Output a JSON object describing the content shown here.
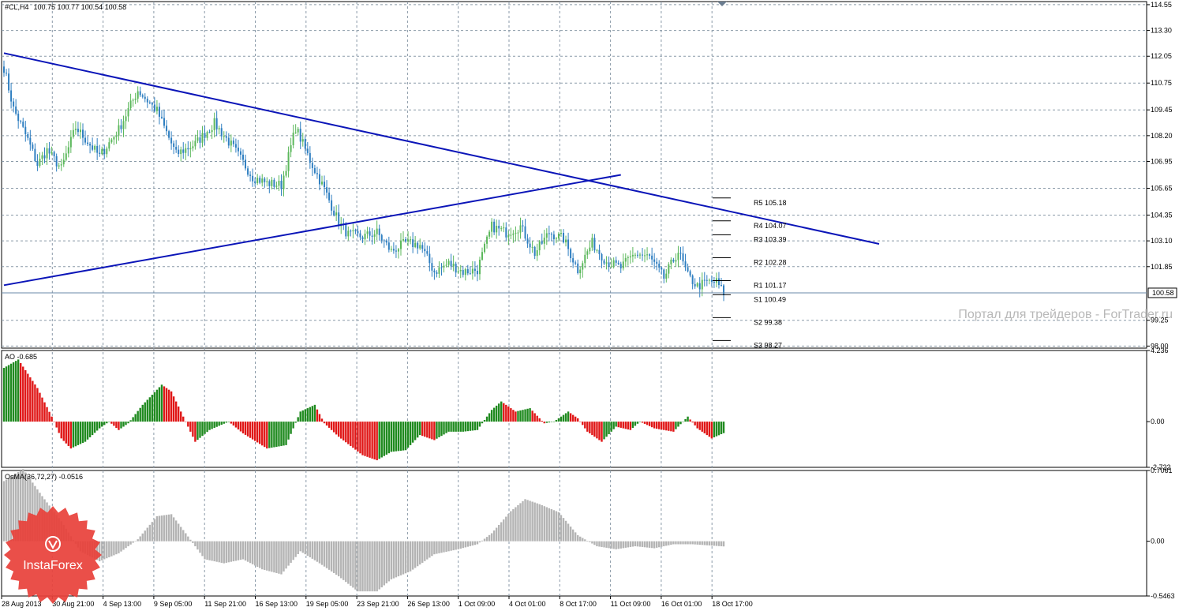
{
  "colors": {
    "background": "#ffffff",
    "grid": "#8a9aa8",
    "bull_candle": "#5cb85c",
    "bear_candle": "#2f7fc1",
    "trendline": "#0b15b8",
    "ao_up": "#1f8a1f",
    "ao_down": "#e01616",
    "osma": "#b4b4b4",
    "watermark": "#b8b8b8",
    "badge": "#e8403a"
  },
  "header": {
    "symbol_label": "#CL,H4",
    "ohlc": "100.75 100.77 100.54 100.58"
  },
  "price_axis": {
    "ticks": [
      "114.55",
      "113.30",
      "112.05",
      "110.75",
      "109.45",
      "108.20",
      "106.95",
      "105.65",
      "104.35",
      "103.10",
      "101.85",
      "99.25",
      "98.00"
    ],
    "current_price": "100.58"
  },
  "pivot_levels": [
    {
      "label": "R5 105.18",
      "value": 105.18
    },
    {
      "label": "R4 104.07",
      "value": 104.07
    },
    {
      "label": "R3 103.39",
      "value": 103.39
    },
    {
      "label": "R2 102.28",
      "value": 102.28
    },
    {
      "label": "R1 101.17",
      "value": 101.17
    },
    {
      "label": "S1 100.49",
      "value": 100.49
    },
    {
      "label": "S2 99.38",
      "value": 99.38
    },
    {
      "label": "S3 98.27",
      "value": 98.27
    }
  ],
  "watermark": "Портал для трейдеров - ForTrader.ru",
  "ao_panel": {
    "label": "AO -0.685",
    "ticks": [
      "4.236",
      "0.00",
      "-2.722"
    ]
  },
  "osma_panel": {
    "label": "OsMA(36,72,27) -0.0516",
    "ticks": [
      "0.7061",
      "0.00",
      "-0.5463"
    ]
  },
  "time_axis": [
    "28 Aug 2013",
    "30 Aug 21:00",
    "4 Sep 13:00",
    "9 Sep 05:00",
    "11 Sep 21:00",
    "16 Sep 13:00",
    "19 Sep 05:00",
    "23 Sep 21:00",
    "26 Sep 13:00",
    "1 Oct 09:00",
    "4 Oct 01:00",
    "8 Oct 17:00",
    "11 Oct 09:00",
    "16 Oct 01:00",
    "18 Oct 17:00"
  ],
  "badge": {
    "text": "InstaForex"
  },
  "chart_data": [
    {
      "type": "candlestick",
      "title": "#CL,H4",
      "ylim": [
        97.9,
        114.7
      ],
      "close_anchors": [
        [
          0,
          111.5
        ],
        [
          4,
          109.5
        ],
        [
          10,
          108.0
        ],
        [
          14,
          106.8
        ],
        [
          18,
          107.5
        ],
        [
          24,
          106.6
        ],
        [
          30,
          108.6
        ],
        [
          40,
          107.2
        ],
        [
          48,
          108.5
        ],
        [
          56,
          110.4
        ],
        [
          64,
          109.4
        ],
        [
          72,
          107.3
        ],
        [
          80,
          107.8
        ],
        [
          88,
          108.8
        ],
        [
          96,
          107.6
        ],
        [
          104,
          106.2
        ],
        [
          110,
          105.9
        ],
        [
          116,
          105.8
        ],
        [
          122,
          108.6
        ],
        [
          128,
          107.0
        ],
        [
          134,
          105.6
        ],
        [
          140,
          104.0
        ],
        [
          144,
          103.4
        ],
        [
          150,
          103.3
        ],
        [
          156,
          103.5
        ],
        [
          162,
          102.6
        ],
        [
          168,
          103.0
        ],
        [
          174,
          102.9
        ],
        [
          180,
          101.6
        ],
        [
          186,
          102.0
        ],
        [
          192,
          101.6
        ],
        [
          198,
          101.7
        ],
        [
          204,
          103.8
        ],
        [
          210,
          103.5
        ],
        [
          216,
          103.8
        ],
        [
          222,
          102.5
        ],
        [
          228,
          103.5
        ],
        [
          234,
          103.2
        ],
        [
          240,
          101.7
        ],
        [
          246,
          103.0
        ],
        [
          252,
          102.1
        ],
        [
          258,
          101.8
        ],
        [
          264,
          102.5
        ],
        [
          270,
          102.3
        ],
        [
          276,
          101.3
        ],
        [
          282,
          102.6
        ],
        [
          286,
          101.4
        ],
        [
          290,
          100.9
        ],
        [
          294,
          101.1
        ],
        [
          298,
          101.1
        ],
        [
          301,
          100.58
        ]
      ],
      "candle_count": 302,
      "trendlines": [
        {
          "name": "descending",
          "from": [
            0,
            112.2
          ],
          "to": [
            366,
            102.95
          ]
        },
        {
          "name": "ascending",
          "from": [
            0,
            100.95
          ],
          "to": [
            258,
            106.3
          ]
        }
      ]
    },
    {
      "type": "histogram",
      "title": "AO -0.685",
      "ylim": [
        -2.722,
        4.236
      ],
      "anchors": [
        [
          0,
          3.2
        ],
        [
          6,
          3.7
        ],
        [
          14,
          2.0
        ],
        [
          20,
          0.3
        ],
        [
          24,
          -1.0
        ],
        [
          28,
          -1.6
        ],
        [
          34,
          -1.2
        ],
        [
          40,
          -0.4
        ],
        [
          44,
          0.0
        ],
        [
          48,
          -0.5
        ],
        [
          52,
          -0.1
        ],
        [
          58,
          1.0
        ],
        [
          66,
          2.2
        ],
        [
          70,
          1.8
        ],
        [
          76,
          0.0
        ],
        [
          80,
          -1.2
        ],
        [
          86,
          -0.5
        ],
        [
          94,
          0.0
        ],
        [
          100,
          -0.7
        ],
        [
          110,
          -1.6
        ],
        [
          118,
          -1.4
        ],
        [
          124,
          0.6
        ],
        [
          130,
          1.0
        ],
        [
          134,
          -0.1
        ],
        [
          140,
          -0.9
        ],
        [
          150,
          -2.0
        ],
        [
          156,
          -2.3
        ],
        [
          162,
          -1.8
        ],
        [
          168,
          -1.7
        ],
        [
          174,
          -0.8
        ],
        [
          180,
          -1.1
        ],
        [
          186,
          -0.6
        ],
        [
          192,
          -0.6
        ],
        [
          198,
          -0.5
        ],
        [
          204,
          0.7
        ],
        [
          208,
          1.2
        ],
        [
          214,
          0.6
        ],
        [
          220,
          0.8
        ],
        [
          226,
          -0.1
        ],
        [
          230,
          0.0
        ],
        [
          236,
          0.6
        ],
        [
          240,
          0.2
        ],
        [
          244,
          -0.6
        ],
        [
          250,
          -1.2
        ],
        [
          256,
          -0.3
        ],
        [
          262,
          -0.5
        ],
        [
          266,
          0.0
        ],
        [
          272,
          -0.4
        ],
        [
          280,
          -0.6
        ],
        [
          286,
          0.3
        ],
        [
          290,
          -0.4
        ],
        [
          296,
          -1.0
        ],
        [
          301,
          -0.685
        ]
      ],
      "colors_by_change": true
    },
    {
      "type": "histogram",
      "title": "OsMA(36,72,27) -0.0516",
      "ylim": [
        -0.5463,
        0.7061
      ],
      "anchors": [
        [
          0,
          0.6
        ],
        [
          8,
          0.72
        ],
        [
          16,
          0.45
        ],
        [
          24,
          0.2
        ],
        [
          32,
          -0.1
        ],
        [
          40,
          -0.2
        ],
        [
          48,
          -0.12
        ],
        [
          56,
          0.02
        ],
        [
          64,
          0.25
        ],
        [
          70,
          0.27
        ],
        [
          76,
          0.08
        ],
        [
          84,
          -0.18
        ],
        [
          92,
          -0.22
        ],
        [
          100,
          -0.18
        ],
        [
          108,
          -0.28
        ],
        [
          116,
          -0.33
        ],
        [
          124,
          -0.1
        ],
        [
          132,
          -0.22
        ],
        [
          140,
          -0.35
        ],
        [
          148,
          -0.5
        ],
        [
          156,
          -0.5
        ],
        [
          162,
          -0.38
        ],
        [
          170,
          -0.3
        ],
        [
          180,
          -0.13
        ],
        [
          190,
          -0.08
        ],
        [
          198,
          -0.03
        ],
        [
          204,
          0.08
        ],
        [
          212,
          0.3
        ],
        [
          218,
          0.42
        ],
        [
          224,
          0.37
        ],
        [
          232,
          0.29
        ],
        [
          240,
          0.06
        ],
        [
          248,
          -0.05
        ],
        [
          256,
          -0.08
        ],
        [
          264,
          -0.05
        ],
        [
          272,
          -0.07
        ],
        [
          280,
          -0.03
        ],
        [
          288,
          -0.03
        ],
        [
          294,
          -0.04
        ],
        [
          301,
          -0.0516
        ]
      ]
    }
  ]
}
